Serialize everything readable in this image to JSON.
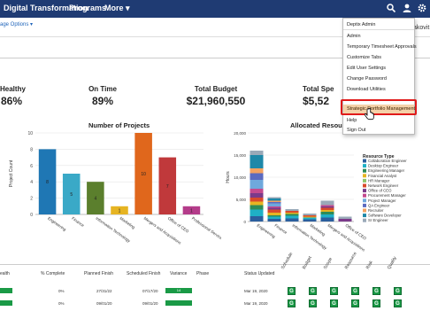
{
  "nav": {
    "title": "Digital Transformation",
    "programs": "Programs",
    "more": "More ▾"
  },
  "subbar": {
    "page_options": "age Options ▾",
    "user_fragment": "akovit"
  },
  "kpis": [
    {
      "label": "Healthy",
      "value": "86%"
    },
    {
      "label": "On Time",
      "value": "89%"
    },
    {
      "label": "Total Budget",
      "value": "$21,960,550"
    },
    {
      "label": "Total Spe",
      "value": "$5,52"
    }
  ],
  "chart_data": [
    {
      "type": "bar",
      "title": "Number of Projects",
      "ylabel": "Project Count",
      "ylim": [
        0,
        10
      ],
      "yticks": [
        0,
        2,
        4,
        6,
        8,
        10
      ],
      "categories": [
        "Engineering",
        "Finance",
        "Information Technology",
        "Marketing",
        "Mergers and Acquisitions",
        "Office of CEO",
        "Professional Services"
      ],
      "values": [
        8,
        5,
        4,
        1,
        10,
        7,
        1
      ],
      "data_labels": [
        "8",
        "5",
        "4",
        "1",
        "10",
        "7",
        "1"
      ],
      "colors": [
        "#1f77b4",
        "#3aa9c7",
        "#5b7f2d",
        "#e6b422",
        "#e0671c",
        "#c0393b",
        "#b43c8a"
      ]
    },
    {
      "type": "bar",
      "title": "Allocated Resource",
      "ylabel": "Hours",
      "ylim": [
        0,
        20000
      ],
      "yticks": [
        "0",
        "5,000",
        "10,000",
        "15,000",
        "20,000"
      ],
      "categories": [
        "Engineering",
        "Finance",
        "Information Technology",
        "Marketing",
        "Mergers and Acquisitions",
        "Office of CEO"
      ],
      "legend_title": "Resource Type",
      "legend": [
        {
          "name": "Collaboration Engineer",
          "color": "#2b5f9e"
        },
        {
          "name": "Desktop Engineer",
          "color": "#1fb0c6"
        },
        {
          "name": "Engineering Manager",
          "color": "#2e8b57"
        },
        {
          "name": "Financial Analyst",
          "color": "#e6b422"
        },
        {
          "name": "HR Manager",
          "color": "#8fc46b"
        },
        {
          "name": "Network Engineer",
          "color": "#d94a2b"
        },
        {
          "name": "Office of CEO",
          "color": "#7b3a8a"
        },
        {
          "name": "Procurement Manager",
          "color": "#c44a8f"
        },
        {
          "name": "Project Manager",
          "color": "#6fa8dc"
        },
        {
          "name": "QA Engineer",
          "color": "#5c6bc0"
        },
        {
          "name": "Recruiter",
          "color": "#f4a261"
        },
        {
          "name": "Software Developer",
          "color": "#1e88a8"
        },
        {
          "name": "Sr Engineer",
          "color": "#9aa9b8"
        }
      ],
      "series": [
        {
          "name": "Collaboration Engineer",
          "values": [
            1200,
            600,
            700,
            500,
            900,
            0
          ]
        },
        {
          "name": "Desktop Engineer",
          "values": [
            1500,
            500,
            600,
            400,
            700,
            0
          ]
        },
        {
          "name": "Engineering Manager",
          "values": [
            1000,
            300,
            400,
            0,
            600,
            0
          ]
        },
        {
          "name": "Financial Analyst",
          "values": [
            800,
            600,
            300,
            200,
            400,
            0
          ]
        },
        {
          "name": "HR Manager",
          "values": [
            0,
            0,
            0,
            0,
            0,
            0
          ]
        },
        {
          "name": "Network Engineer",
          "values": [
            900,
            700,
            400,
            300,
            500,
            0
          ]
        },
        {
          "name": "Office of CEO",
          "values": [
            1000,
            400,
            0,
            0,
            300,
            600
          ]
        },
        {
          "name": "Procurement Manager",
          "values": [
            1000,
            300,
            0,
            0,
            300,
            0
          ]
        },
        {
          "name": "Project Manager",
          "values": [
            2000,
            700,
            0,
            0,
            0,
            0
          ]
        },
        {
          "name": "QA Engineer",
          "values": [
            1500,
            300,
            0,
            0,
            0,
            0
          ]
        },
        {
          "name": "Recruiter",
          "values": [
            1100,
            300,
            0,
            0,
            0,
            0
          ]
        },
        {
          "name": "Software Developer",
          "values": [
            3000,
            500,
            0,
            0,
            0,
            0
          ]
        },
        {
          "name": "Sr Engineer",
          "values": [
            1000,
            300,
            400,
            400,
            1000,
            500
          ]
        }
      ]
    }
  ],
  "table": {
    "headers": [
      "ealth",
      "% Complete",
      "Planned Finish",
      "Scheduled Finish",
      "Variance",
      "Phase",
      "Status Updated",
      "Schedule",
      "Budget",
      "Scope",
      "Resource",
      "Risk",
      "Quality"
    ],
    "rows": [
      {
        "pct": "0%",
        "planned": "27/31/22",
        "scheduled": "07/17/20",
        "variance": "14",
        "updated": "Mar 19, 2020",
        "grades": [
          "G",
          "G",
          "G",
          "G",
          "G",
          "G"
        ]
      },
      {
        "pct": "0%",
        "planned": "09/01/20",
        "scheduled": "09/01/20",
        "variance": "",
        "updated": "Mar 19, 2020",
        "grades": [
          "G",
          "G",
          "G",
          "G",
          "G",
          "G"
        ]
      }
    ]
  },
  "menu": {
    "items": [
      "Deptix Admin",
      "Admin",
      "Temporary Timesheet Approvals",
      "Customize Tabs",
      "Edit User Settings",
      "Change Password",
      "Download Utilities",
      "Strategic Portfolio Management",
      "Help",
      "Sign Out"
    ],
    "highlighted": "Strategic Portfolio Management"
  }
}
